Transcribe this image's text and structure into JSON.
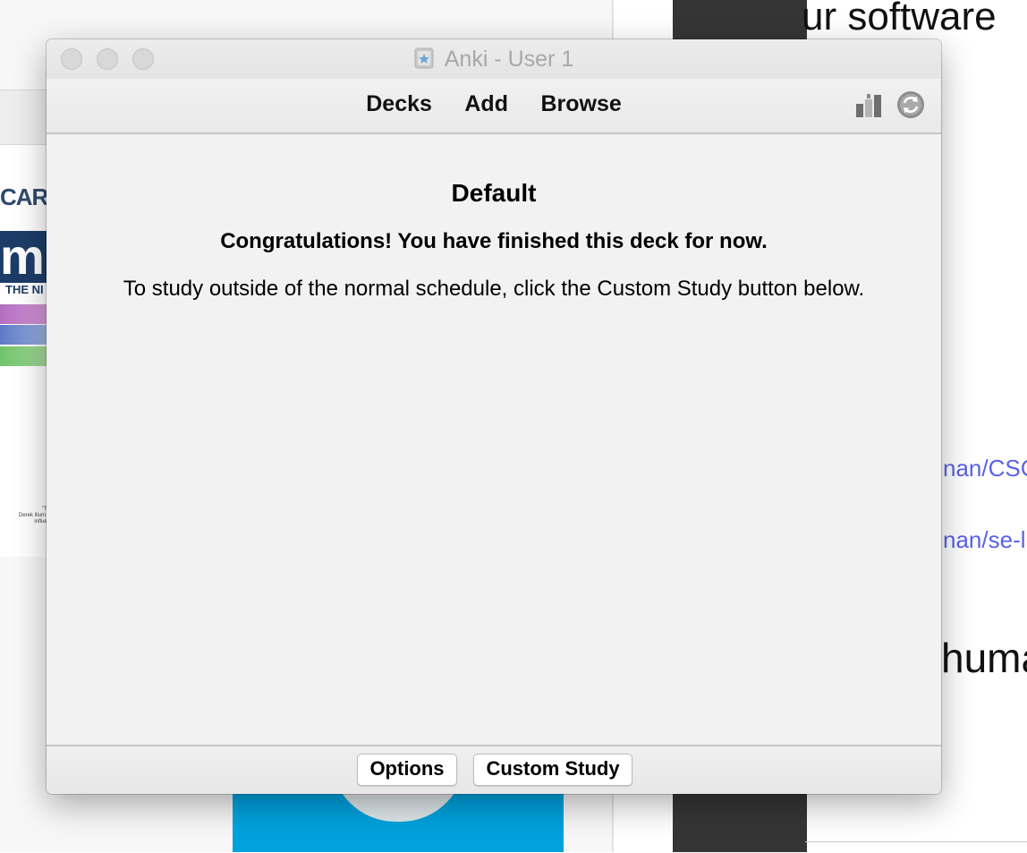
{
  "window": {
    "title": "Anki - User 1"
  },
  "toolbar": {
    "nav": [
      "Decks",
      "Add",
      "Browse"
    ],
    "right_icons": [
      "stats-icon",
      "sync-icon"
    ]
  },
  "main": {
    "deck_name": "Default",
    "congrats": "Congratulations! You have finished this deck for now.",
    "custom_study_message": "To study outside of the normal schedule, click the Custom Study button below."
  },
  "bottom": {
    "options_label": "Options",
    "custom_study_label": "Custom Study"
  },
  "background": {
    "book_caro": "CARO",
    "book_m": "m",
    "book_sub": "THE NI",
    "book_tiny": "\"Th\nDerek illum a\ninfluen",
    "right_top": "ur software",
    "link1": "nan/CSC",
    "link2": "nan/se-l",
    "right_mid": "huma"
  },
  "colors": {
    "window_bg": "#f2f2f2",
    "link": "#5a63e6",
    "dark_column": "#353535"
  }
}
